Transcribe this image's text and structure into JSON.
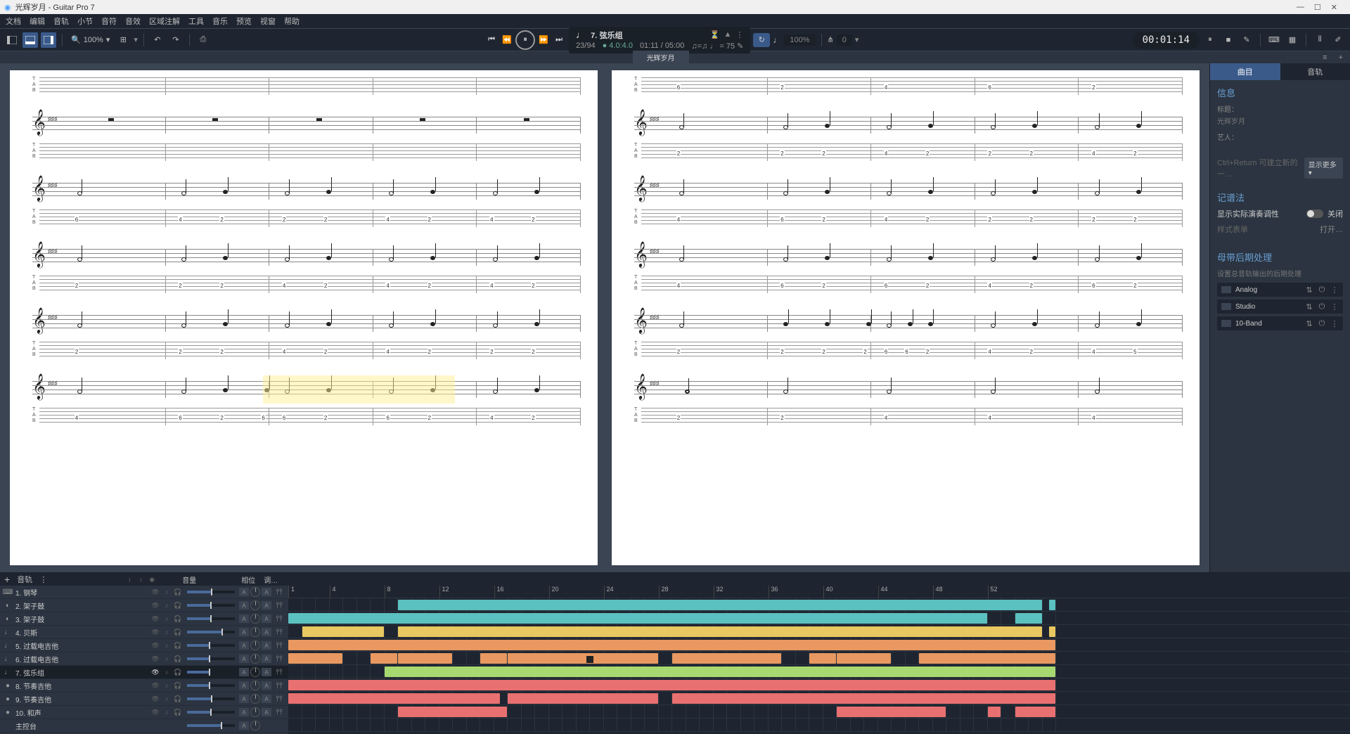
{
  "titlebar": {
    "title": "光辉岁月 - Guitar Pro 7"
  },
  "menu": [
    "文档",
    "编辑",
    "音轨",
    "小节",
    "音符",
    "音效",
    "区域注解",
    "工具",
    "音乐",
    "预览",
    "视窗",
    "帮助"
  ],
  "toolbar": {
    "zoom": "100%"
  },
  "transport": {
    "track_num": "7.",
    "track_name": "弦乐组",
    "bar_pos": "23/94",
    "beat_sig": "4.0:4.0",
    "time_pos": "01:11 / 05:00",
    "tempo_val": "= 75",
    "speed_pct": "100%",
    "capo": "0",
    "clock": "00:01:14"
  },
  "tab": {
    "title": "光辉岁月"
  },
  "right_panel": {
    "tab1": "曲目",
    "tab2": "音轨",
    "info_heading": "信息",
    "title_label": "标题：",
    "title_value": "光辉岁月",
    "artist_label": "艺人：",
    "shortcut_tip": "Ctrl+Return 可建立新的一…",
    "show_more": "显示更多 ▾",
    "notation_heading": "记谱法",
    "show_tuning": "显示实际演奏调性",
    "off_label": "关闭",
    "style_list": "样式表单",
    "open_label": "打开…",
    "mastering_heading": "母带后期处理",
    "mastering_sub": "设置总音轨输出的后期处理",
    "fx": [
      "Analog",
      "Studio",
      "10-Band"
    ]
  },
  "tracks_header": {
    "add": "+",
    "label": "音轨",
    "vol": "音量",
    "pan": "相位",
    "eq": "调…"
  },
  "tracks": [
    {
      "num": "1.",
      "name": "钢琴",
      "icon": "⌨",
      "vol": 50
    },
    {
      "num": "2.",
      "name": "架子鼓",
      "icon": "◐",
      "vol": 48
    },
    {
      "num": "3.",
      "name": "架子鼓",
      "icon": "◐",
      "vol": 48
    },
    {
      "num": "4.",
      "name": "贝斯",
      "icon": "♩",
      "vol": 72
    },
    {
      "num": "5.",
      "name": "过载电吉他",
      "icon": "♩",
      "vol": 46
    },
    {
      "num": "6.",
      "name": "过载电吉他",
      "icon": "♩",
      "vol": 46
    },
    {
      "num": "7.",
      "name": "弦乐组",
      "icon": "♩",
      "vol": 46,
      "selected": true,
      "visible": true
    },
    {
      "num": "8.",
      "name": "节奏吉他",
      "icon": "●",
      "vol": 46
    },
    {
      "num": "9.",
      "name": "节奏吉他",
      "icon": "●",
      "vol": 50
    },
    {
      "num": "10.",
      "name": "和声",
      "icon": "●",
      "vol": 48
    }
  ],
  "master_label": "主控台",
  "timeline_bars": [
    1,
    4,
    8,
    12,
    16,
    20,
    24,
    28,
    32,
    36,
    40,
    44,
    48,
    52
  ],
  "clips": {
    "row0": [
      {
        "s": 8,
        "e": 55,
        "c": "teal"
      },
      {
        "s": 55.5,
        "e": 56,
        "c": "teal"
      }
    ],
    "row1": [
      {
        "s": 0,
        "e": 51,
        "c": "teal"
      },
      {
        "s": 53,
        "e": 55,
        "c": "teal"
      }
    ],
    "row2": [
      {
        "s": 1,
        "e": 7,
        "c": "yellow"
      },
      {
        "s": 8,
        "e": 55,
        "c": "yellow"
      },
      {
        "s": 55.5,
        "e": 56,
        "c": "yellow"
      }
    ],
    "row3": [
      {
        "s": 0,
        "e": 56,
        "c": "orange"
      }
    ],
    "row4": [
      {
        "s": 0,
        "e": 4,
        "c": "orange"
      },
      {
        "s": 6,
        "e": 8,
        "c": "orange"
      },
      {
        "s": 8,
        "e": 12,
        "c": "orange"
      },
      {
        "s": 14,
        "e": 16,
        "c": "orange"
      },
      {
        "s": 16,
        "e": 27,
        "c": "orange"
      },
      {
        "s": 28,
        "e": 36,
        "c": "orange"
      },
      {
        "s": 38,
        "e": 40,
        "c": "orange"
      },
      {
        "s": 40,
        "e": 44,
        "c": "orange"
      },
      {
        "s": 46,
        "e": 56,
        "c": "orange"
      }
    ],
    "row5": [
      {
        "s": 7,
        "e": 56,
        "c": "green"
      }
    ],
    "row6": [
      {
        "s": 0,
        "e": 56,
        "c": "red"
      }
    ],
    "row7": [
      {
        "s": 0,
        "e": 15.5,
        "c": "red"
      },
      {
        "s": 16,
        "e": 27,
        "c": "red"
      },
      {
        "s": 28,
        "e": 56,
        "c": "red"
      }
    ],
    "row8": [
      {
        "s": 8,
        "e": 16,
        "c": "red"
      },
      {
        "s": 40,
        "e": 48,
        "c": "red"
      },
      {
        "s": 51,
        "e": 52,
        "c": "red"
      },
      {
        "s": 53,
        "e": 56,
        "c": "red"
      }
    ]
  },
  "score": {
    "left_page": {
      "systems": [
        {
          "bars": 5,
          "notes": [
            [],
            [],
            [],
            [],
            []
          ],
          "tabs": [
            [],
            [],
            [],
            [],
            []
          ],
          "tab_only": true
        },
        {
          "bars": 5,
          "notes": [
            [
              "rest"
            ],
            [
              "rest"
            ],
            [
              "rest"
            ],
            [
              "rest"
            ],
            [
              "rest"
            ]
          ],
          "tabs": [
            [],
            [],
            [],
            [],
            []
          ]
        },
        {
          "bars": 5,
          "notes": [
            [
              "h"
            ],
            [
              "h",
              "q"
            ],
            [
              "h",
              "q"
            ],
            [
              "h",
              "q"
            ],
            [
              "h",
              "q"
            ]
          ],
          "tabs": [
            [
              "6"
            ],
            [
              "4",
              "2"
            ],
            [
              "2",
              "2"
            ],
            [
              "4",
              "2"
            ],
            [
              "4",
              "2"
            ]
          ]
        },
        {
          "bars": 5,
          "notes": [
            [
              "h"
            ],
            [
              "h",
              "q"
            ],
            [
              "h",
              "q"
            ],
            [
              "h",
              "q"
            ],
            [
              "h",
              "q"
            ]
          ],
          "tabs": [
            [
              "2"
            ],
            [
              "2",
              "2"
            ],
            [
              "4",
              "2"
            ],
            [
              "4",
              "2"
            ],
            [
              "4",
              "2"
            ]
          ]
        },
        {
          "bars": 5,
          "notes": [
            [
              "h"
            ],
            [
              "h",
              "q"
            ],
            [
              "h",
              "q"
            ],
            [
              "h",
              "q"
            ],
            [
              "h",
              "q"
            ]
          ],
          "tabs": [
            [
              "2"
            ],
            [
              "2",
              "2"
            ],
            [
              "4",
              "2"
            ],
            [
              "4",
              "2"
            ],
            [
              "2",
              "2"
            ]
          ]
        },
        {
          "bars": 5,
          "notes": [
            [
              "h"
            ],
            [
              "h",
              "q",
              "q"
            ],
            [
              "h",
              "q"
            ],
            [
              "h",
              "q"
            ],
            [
              "h",
              "q"
            ]
          ],
          "tabs": [
            [
              "4"
            ],
            [
              "6",
              "2",
              "6"
            ],
            [
              "6",
              "2"
            ],
            [
              "6",
              "2"
            ],
            [
              "4",
              "2"
            ]
          ]
        }
      ]
    },
    "right_page": {
      "systems": [
        {
          "bars": 5,
          "notes": [
            [],
            [],
            [],
            [],
            []
          ],
          "tabs": [
            [
              "6"
            ],
            [
              "2"
            ],
            [
              "4"
            ],
            [
              "6"
            ],
            [
              "2"
            ]
          ],
          "tab_only": true
        },
        {
          "bars": 5,
          "notes": [
            [
              "h"
            ],
            [
              "h",
              "q"
            ],
            [
              "h",
              "q"
            ],
            [
              "h",
              "q"
            ],
            [
              "h",
              "q"
            ]
          ],
          "tabs": [
            [
              "2"
            ],
            [
              "2",
              "2"
            ],
            [
              "4",
              "2"
            ],
            [
              "2",
              "2"
            ],
            [
              "4",
              "2"
            ]
          ]
        },
        {
          "bars": 5,
          "notes": [
            [
              "h"
            ],
            [
              "h",
              "q"
            ],
            [
              "h",
              "q"
            ],
            [
              "h",
              "q"
            ],
            [
              "h",
              "q"
            ]
          ],
          "tabs": [
            [
              "4"
            ],
            [
              "6",
              "2"
            ],
            [
              "4",
              "2"
            ],
            [
              "2",
              "2"
            ],
            [
              "2",
              "2"
            ]
          ]
        },
        {
          "bars": 5,
          "notes": [
            [
              "h"
            ],
            [
              "h",
              "q"
            ],
            [
              "h",
              "q"
            ],
            [
              "h",
              "q"
            ],
            [
              "h",
              "q"
            ]
          ],
          "tabs": [
            [
              "4"
            ],
            [
              "6",
              "2"
            ],
            [
              "6",
              "2"
            ],
            [
              "4",
              "2"
            ],
            [
              "6",
              "2"
            ]
          ]
        },
        {
          "bars": 5,
          "notes": [
            [
              "h"
            ],
            [
              "q",
              "q",
              "q",
              "q"
            ],
            [
              "h",
              "q"
            ],
            [
              "h",
              "q"
            ],
            [
              "h",
              "q"
            ]
          ],
          "tabs": [
            [
              "2"
            ],
            [
              "2",
              "2",
              "2",
              "6"
            ],
            [
              "6",
              "2"
            ],
            [
              "4",
              "2"
            ],
            [
              "4",
              "5"
            ]
          ]
        },
        {
          "bars": 5,
          "notes": [
            [
              "w"
            ],
            [
              "h"
            ],
            [
              "h"
            ],
            [
              "h"
            ],
            [
              "h"
            ]
          ],
          "tabs": [
            [
              "2"
            ],
            [
              "2"
            ],
            [
              "4"
            ],
            [
              "4"
            ],
            [
              "4"
            ]
          ]
        }
      ]
    }
  }
}
